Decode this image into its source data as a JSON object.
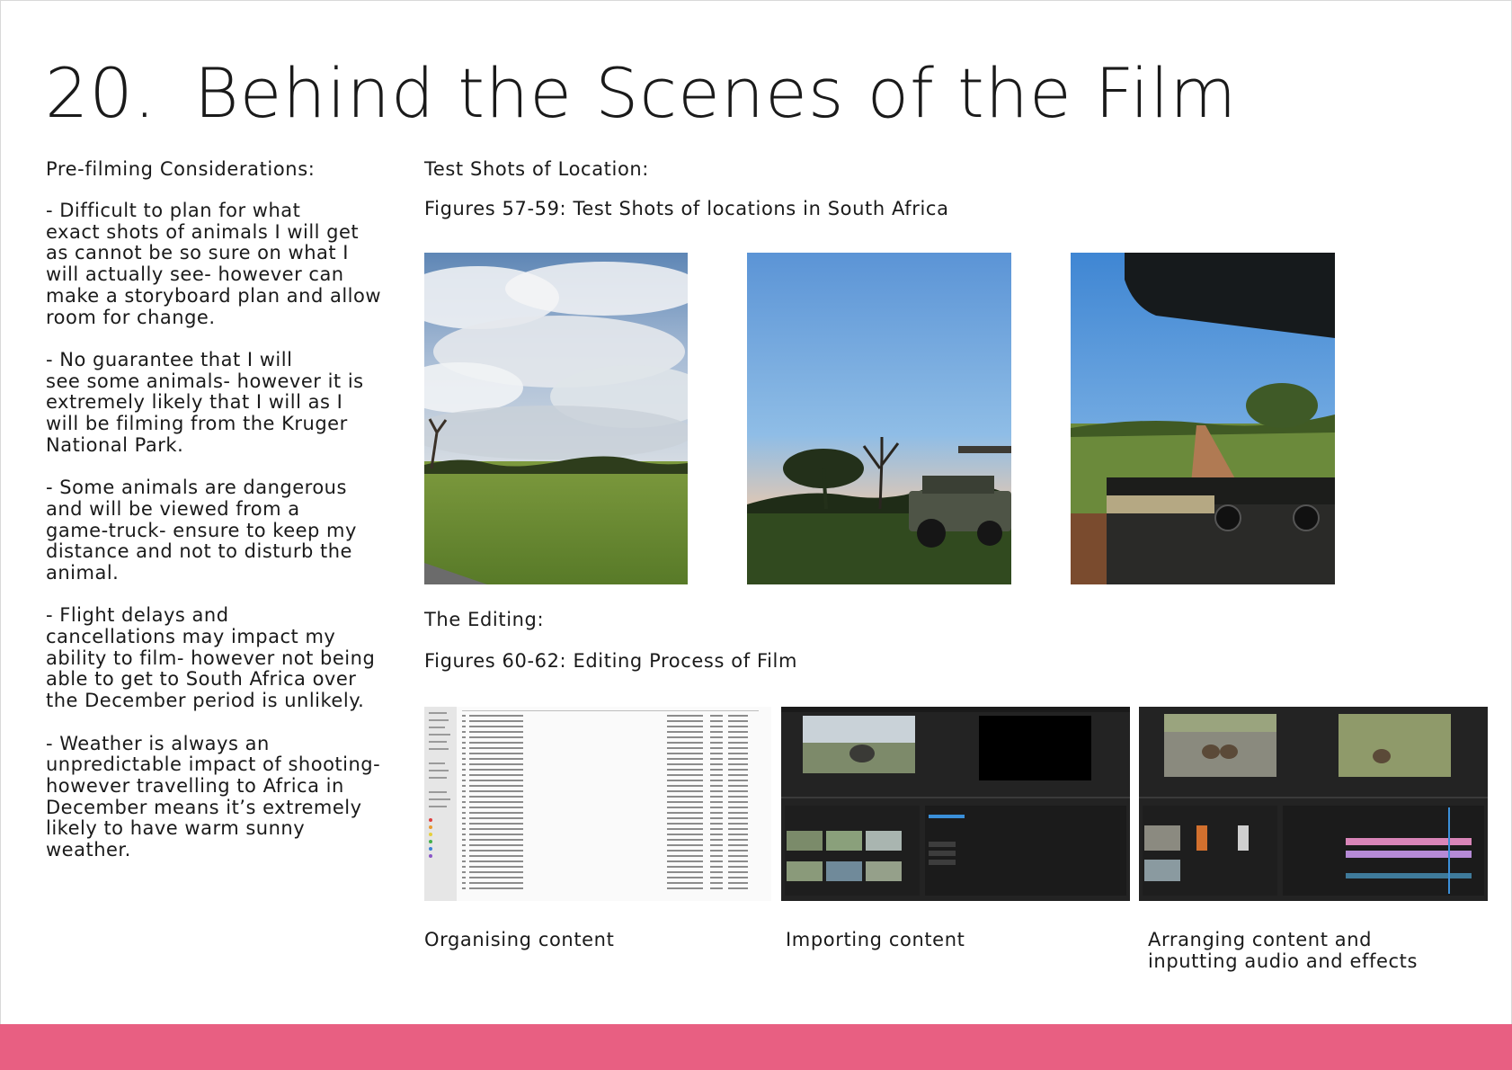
{
  "page": {
    "number": "20.",
    "title": "Behind the Scenes of the Film"
  },
  "considerations": {
    "heading": "Pre-filming Considerations:",
    "items": [
      "-      Difficult to plan for what\nexact shots of animals I will get\nas cannot be so sure on what I\nwill actually see- however can\nmake a storyboard plan and allow\nroom for change.",
      "-      No guarantee that I will\nsee some animals- however it is\nextremely likely that I will as I\nwill be filming from the Kruger\nNational Park.",
      "-      Some animals are dangerous\nand will be viewed from a\ngame-truck- ensure to keep my\ndistance and not to disturb the\nanimal.",
      "-      Flight delays and\ncancellations may impact my\nability to film- however not being\nable to get to South Africa over\nthe December period is unlikely.",
      "-      Weather is always an\nunpredictable impact of shooting-\nhowever travelling to Africa in\nDecember means it’s extremely\nlikely to have warm sunny\nweather."
    ]
  },
  "location": {
    "heading": "Test Shots of Location:",
    "figures_caption": "Figures 57-59: Test Shots of locations in South Africa"
  },
  "editing": {
    "heading": "The Editing:",
    "figures_caption": "Figures 60-62: Editing Process of Film",
    "captions": [
      "Organising content",
      "Importing content",
      "Arranging content and\ninputting audio and effects"
    ]
  },
  "colors": {
    "footer": "#e85f82",
    "text": "#1a1a1a"
  }
}
